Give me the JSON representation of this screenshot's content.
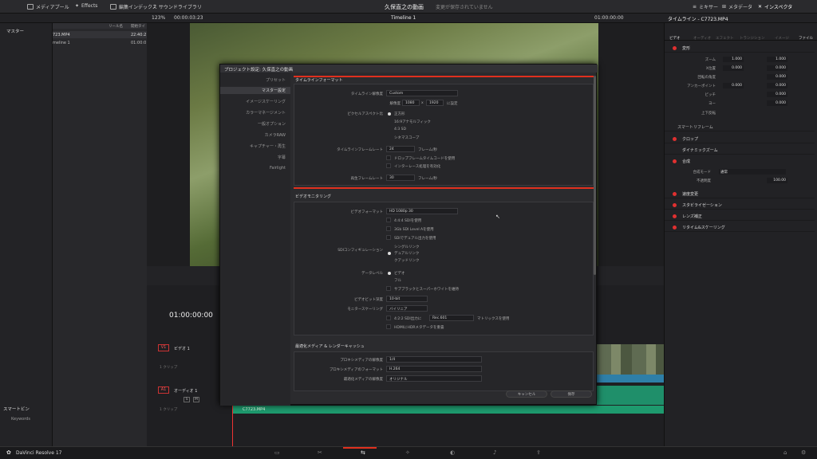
{
  "topbar": {
    "media_pool": "メディアプール",
    "effects": "Effects",
    "edit_index": "編集インデックス",
    "sound_library": "サウンドライブラリ",
    "project_title": "久保直之の動画",
    "save_status": "変更が保存されていません",
    "mixer": "ミキサー",
    "metadata": "メタデータ",
    "inspector": "インスペクタ"
  },
  "secbar": {
    "zoom": "123%",
    "timecode_left": "00:00:03:23",
    "timeline_name": "Timeline 1",
    "timecode_right": "01:00:00:00",
    "clip_title": "タイムライン - C7723.MP4"
  },
  "leftpanel": {
    "master": "マスター",
    "smart_bin": "スマートビン",
    "keywords": "Keywords"
  },
  "mediapool": {
    "col_name": "リール名",
    "col_start": "開始タイ",
    "items": [
      {
        "name": "723.MP4",
        "time": "22:40:2"
      },
      {
        "name": "meline 1",
        "time": "01:00:0"
      }
    ]
  },
  "modal": {
    "title": "プロジェクト設定:  久保直之の動画",
    "nav": [
      "プリセット",
      "マスター設定",
      "イメージスケーリング",
      "カラーマネージメント",
      "一般オプション",
      "カメラRAW",
      "キャプチャー・再生",
      "字幕",
      "Fairlight"
    ],
    "timeline_format": {
      "header": "タイムラインフォーマット",
      "resolution_label": "タイムライン解像度",
      "resolution_value": "Custom",
      "res_label": "解像度",
      "res_w": "1080",
      "x": "x",
      "res_h": "1920",
      "res_unit": "に設定",
      "pixel_aspect_label": "ピクセルアスペクト比",
      "pixel_options": [
        "正方形",
        "16:9アナモルフィック",
        "4:3 SD",
        "シネマスコープ"
      ],
      "frame_rate_label": "タイムラインフレームレート",
      "frame_rate_value": "24",
      "fps_unit": "フレーム/秒",
      "dropframe": "ドロップフレームタイムコードを使用",
      "interlace": "インターレース処理を有効化",
      "playback_label": "再生フレームレート",
      "playback_value": "30",
      "playback_unit": "フレーム/秒"
    },
    "video_monitoring": {
      "header": "ビデオモニタリング",
      "video_format_label": "ビデオフォーマット",
      "video_format_value": "HD 1080p 30",
      "checks": [
        "4:4:4 SDIを使用",
        "3Gb SDI Level Aを使用",
        "SDIでデュアル出力を使用"
      ],
      "sdi_label": "SDIコンフィギュレーション",
      "sdi_options": [
        "シングルリンク",
        "デュアルリンク",
        "クアッドリンク"
      ],
      "data_level_label": "データレベル",
      "data_level_options": [
        "ビデオ",
        "フル"
      ],
      "retain": "サブブラックとスーパーホワイトを維持",
      "bit_depth_label": "ビデオビット深度",
      "bit_depth_value": "10-bit",
      "scaling_label": "モニタースケーリング",
      "scaling_value": "バイリニア",
      "output_422": "4:2:2 SDI出力に",
      "rec_value": "Rec.601",
      "matrix": "マトリックスを使用",
      "hdmi": "HDMIにHDRメタデータを重畳"
    },
    "optimized": {
      "header": "最適化メディア & レンダーキャッシュ",
      "proxy_res_label": "プロキシメディアの解像度",
      "proxy_res_value": "1/4",
      "proxy_fmt_label": "プロキシメディアのフォーマット",
      "proxy_fmt_value": "H.264",
      "opt_res_label": "最適化メディアの解像度",
      "opt_res_value": "オリジナル"
    },
    "cancel": "キャンセル",
    "save": "保存"
  },
  "inspector": {
    "tabs": [
      "ビデオ",
      "オーディオ",
      "エフェクト",
      "トランジション",
      "イメージ",
      "ファイル"
    ],
    "transform": "変形",
    "zoom_label": "ズーム",
    "zoom_x": "1.000",
    "zoom_y": "1.000",
    "pos_label": "X位置",
    "pos_x": "0.000",
    "pos_y": "0.000",
    "rot_label": "回転の角度",
    "rot_val": "0.000",
    "anchor_label": "アンカーポイント",
    "anchor_x": "0.000",
    "anchor_y": "0.000",
    "pitch_label": "ピッチ",
    "pitch_val": "0.000",
    "yaw_label": "ヨー",
    "yaw_val": "0.000",
    "flip_label": "上下反転",
    "smart_reframe": "スマートリフレーム",
    "crop": "クロップ",
    "dynamic_zoom": "ダイナミックズーム",
    "composite": "合成",
    "comp_mode_label": "合成モード",
    "comp_mode_val": "通常",
    "opacity_label": "不透明度",
    "opacity_val": "100.00",
    "speed": "速度変更",
    "stabilize": "スタビライゼーション",
    "lens": "レンズ補正",
    "retime": "リタイム&スケーリング"
  },
  "timeline": {
    "timecode": "01:00:00:00",
    "v1": "V1",
    "video1": "ビデオ 1",
    "v1_clips": "1 クリップ",
    "a1": "A1",
    "audio1": "オーディオ 1",
    "a1_clips": "1 クリップ",
    "a1_s": "S",
    "a1_m": "M",
    "clip_name": "C7723.MP4"
  },
  "bottombar": {
    "app_name": "DaVinci Resolve 17"
  }
}
